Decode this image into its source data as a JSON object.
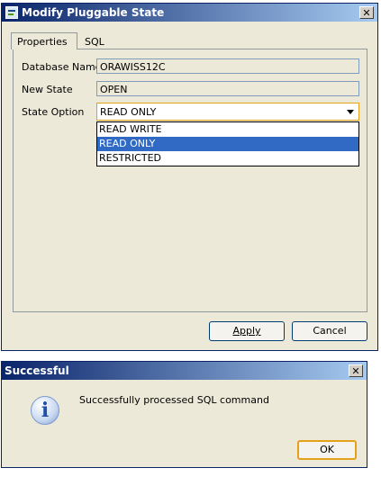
{
  "dialog": {
    "title": "Modify Pluggable State",
    "close_glyph": "✕",
    "tabs": [
      {
        "label": "Properties",
        "active": true
      },
      {
        "label": "SQL",
        "active": false
      }
    ],
    "fields": {
      "database_name": {
        "label": "Database Name",
        "value": "ORAWISS12C"
      },
      "new_state": {
        "label": "New State",
        "value": "OPEN"
      },
      "state_option": {
        "label": "State Option",
        "value": "READ ONLY",
        "options": [
          "READ WRITE",
          "READ ONLY",
          "RESTRICTED"
        ],
        "selected_option": "READ ONLY"
      }
    },
    "buttons": {
      "apply": "Apply",
      "cancel": "Cancel"
    }
  },
  "message": {
    "title": "Successful",
    "close_glyph": "✕",
    "icon": "info-icon",
    "icon_glyph": "i",
    "text": "Successfully processed SQL command",
    "ok": "OK"
  },
  "colors": {
    "titlebar_start": "#0a246a",
    "titlebar_end": "#a6caf0",
    "selection": "#316ac5",
    "focus_border": "#e3a21a",
    "dialog_bg": "#ece9d8"
  }
}
